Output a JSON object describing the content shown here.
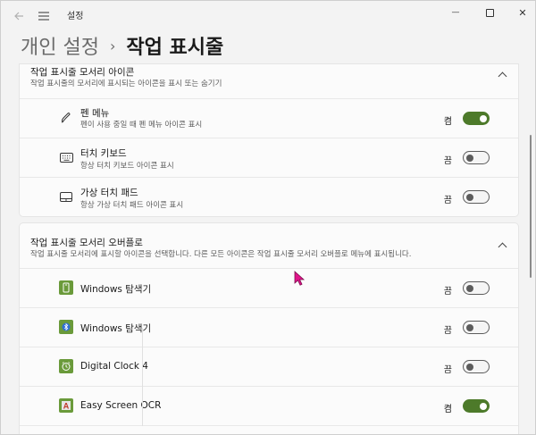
{
  "window": {
    "app_title": "설정",
    "controls": {
      "minimize": "—",
      "close": "✕"
    }
  },
  "header": {
    "parent": "개인 설정",
    "separator": "›",
    "current": "작업 표시줄"
  },
  "section1": {
    "title": "작업 표시줄 모서리 아이콘",
    "subtitle": "작업 표시줄의 모서리에 표시되는 아이콘을 표시 또는 숨기기",
    "items": [
      {
        "title": "펜 메뉴",
        "subtitle": "펜이 사용 중일 때 펜 메뉴 아이콘 표시",
        "state": "켬",
        "on": true,
        "icon": "pen-icon"
      },
      {
        "title": "터치 키보드",
        "subtitle": "항상 터치 키보드 아이콘 표시",
        "state": "끔",
        "on": false,
        "icon": "keyboard-icon"
      },
      {
        "title": "가상 터치 패드",
        "subtitle": "항상 가상 터치 패드 아이콘 표시",
        "state": "끔",
        "on": false,
        "icon": "touchpad-icon"
      }
    ]
  },
  "section2": {
    "title": "작업 표시줄 모서리 오버플로",
    "subtitle": "작업 표시줄 모서리에 표시할 아이콘을 선택합니다. 다른 모든 아이콘은 작업 표시줄 모서리 오버플로 메뉴에 표시됩니다.",
    "items": [
      {
        "title": "Windows 탐색기",
        "state": "끔",
        "on": false,
        "icon": "usb-drive-icon"
      },
      {
        "title": "Windows 탐색기",
        "state": "끔",
        "on": false,
        "icon": "bluetooth-icon"
      },
      {
        "title": "Digital Clock 4",
        "state": "끔",
        "on": false,
        "icon": "clock-icon"
      },
      {
        "title": "Easy Screen OCR",
        "state": "켬",
        "on": true,
        "icon": "ocr-icon"
      }
    ]
  },
  "colors": {
    "accent": "#4d7a2a",
    "app_icon_bg": "#6a9a3a",
    "ocr_icon_bg": "#d0d0d0"
  }
}
